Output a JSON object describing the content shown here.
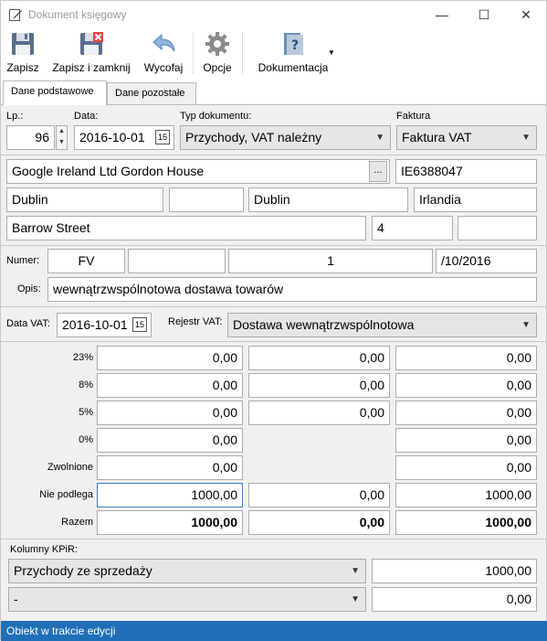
{
  "window": {
    "title": "Dokument księgowy",
    "minimize": "—",
    "maximize": "☐",
    "close": "✕"
  },
  "toolbar": {
    "save": "Zapisz",
    "save_close": "Zapisz i zamknij",
    "undo": "Wycofaj",
    "options": "Opcje",
    "docs": "Dokumentacja"
  },
  "tabs": {
    "basic": "Dane podstawowe",
    "other": "Dane pozostałe"
  },
  "header": {
    "lp_label": "Lp.:",
    "lp_value": "96",
    "date_label": "Data:",
    "date_value": "2016-10-01",
    "type_label": "Typ dokumentu:",
    "type_value": "Przychody, VAT należny",
    "invoice_label": "Faktura",
    "invoice_value": "Faktura VAT"
  },
  "contractor": {
    "name": "Google Ireland Ltd Gordon House",
    "browse": "...",
    "nip": "IE6388047",
    "city": "Dublin",
    "postcode": "",
    "post_city": "Dublin",
    "country": "Irlandia",
    "street": "Barrow Street",
    "house_no": "4",
    "flat_no": ""
  },
  "number": {
    "label": "Numer:",
    "prefix": "FV",
    "part2": "",
    "part3": "1",
    "suffix": "/10/2016",
    "desc_label": "Opis:",
    "desc": "wewnątrzwspólnotowa dostawa towarów"
  },
  "vat": {
    "date_label": "Data VAT:",
    "date_value": "2016-10-01",
    "register_label": "Rejestr VAT:",
    "register_value": "Dostawa wewnątrzwspólnotowa"
  },
  "rates": [
    {
      "label": "23%",
      "net": "0,00",
      "vat": "0,00",
      "gross": "0,00"
    },
    {
      "label": "8%",
      "net": "0,00",
      "vat": "0,00",
      "gross": "0,00"
    },
    {
      "label": "5%",
      "net": "0,00",
      "vat": "0,00",
      "gross": "0,00"
    },
    {
      "label": "0%",
      "net": "0,00",
      "vat": "",
      "gross": "0,00"
    },
    {
      "label": "Zwolnione",
      "net": "0,00",
      "vat": "",
      "gross": "0,00"
    },
    {
      "label": "Nie podlega",
      "net": "1000,00",
      "vat": "0,00",
      "gross": "1000,00"
    },
    {
      "label": "Razem",
      "net": "1000,00",
      "vat": "0,00",
      "gross": "1000,00"
    }
  ],
  "kpir": {
    "label": "Kolumny KPiR:",
    "col1": "Przychody ze sprzedaży",
    "val1": "1000,00",
    "col2": "-",
    "val2": "0,00"
  },
  "status": "Obiekt w trakcie edycji"
}
